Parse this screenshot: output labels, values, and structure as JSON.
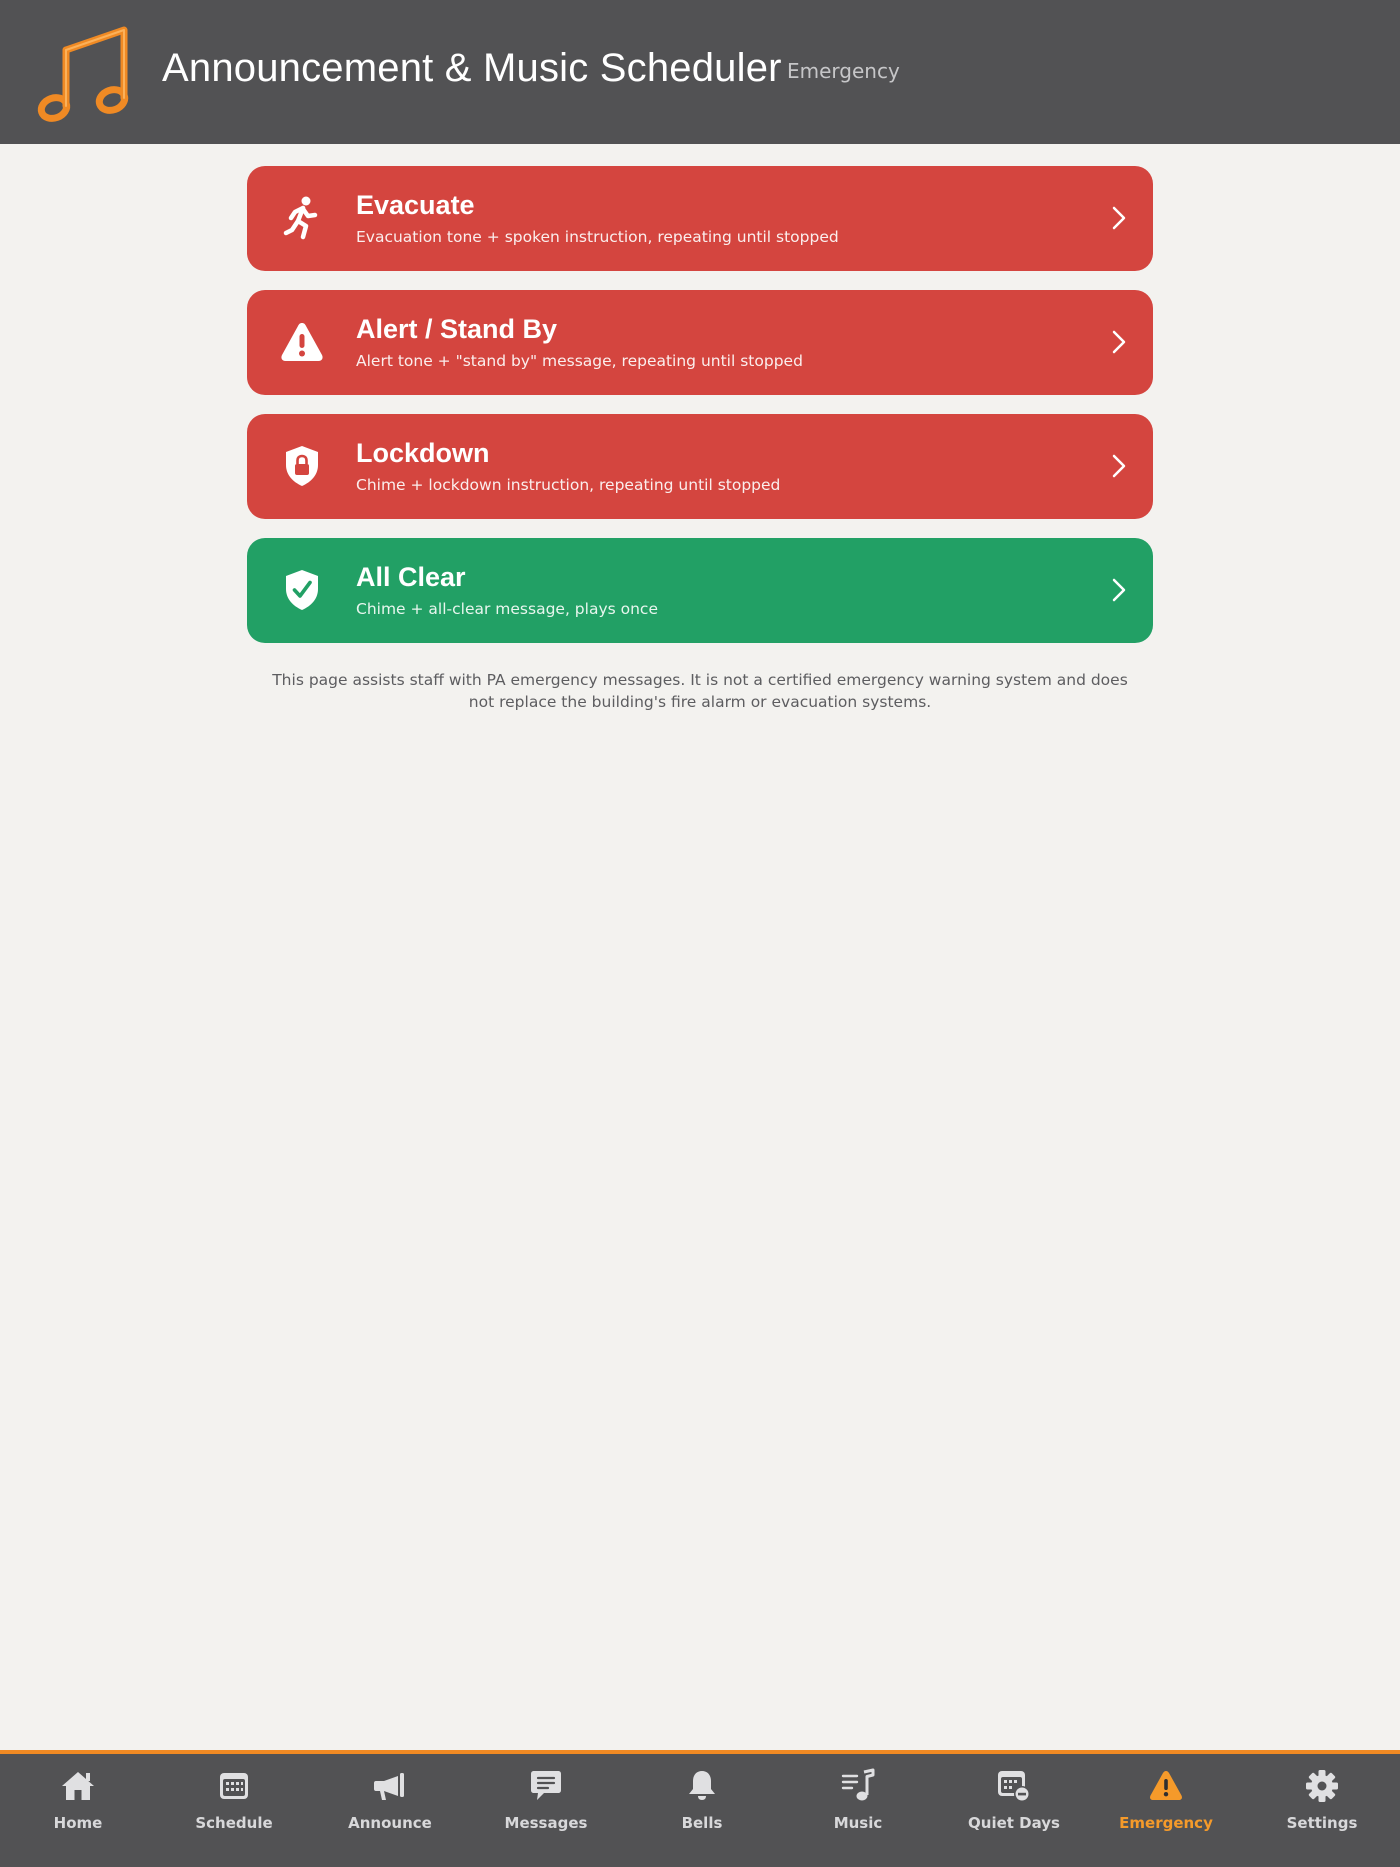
{
  "header": {
    "title": "Announcement & Music Scheduler",
    "page": "Emergency",
    "logo_icon": "music-note-icon",
    "logo_color": "#f08a24"
  },
  "cards": [
    {
      "title": "Evacuate",
      "subtitle": "Evacuation tone + spoken instruction, repeating until stopped",
      "icon": "running-person-icon",
      "color": "#d4453f"
    },
    {
      "title": "Alert / Stand By",
      "subtitle": "Alert tone + \"stand by\" message, repeating until stopped",
      "icon": "warning-triangle-icon",
      "color": "#d4453f"
    },
    {
      "title": "Lockdown",
      "subtitle": "Chime + lockdown instruction, repeating until stopped",
      "icon": "shield-lock-icon",
      "color": "#d4453f"
    },
    {
      "title": "All Clear",
      "subtitle": "Chime + all-clear message, plays once",
      "icon": "shield-check-icon",
      "color": "#22a065"
    }
  ],
  "disclaimer": "This page assists staff with PA emergency messages. It is not a certified emergency warning system and does not replace the building's fire alarm or evacuation systems.",
  "tabs": [
    {
      "label": "Home",
      "icon": "home-icon"
    },
    {
      "label": "Schedule",
      "icon": "calendar-icon"
    },
    {
      "label": "Announce",
      "icon": "megaphone-icon"
    },
    {
      "label": "Messages",
      "icon": "chat-bubble-icon"
    },
    {
      "label": "Bells",
      "icon": "bell-icon"
    },
    {
      "label": "Music",
      "icon": "music-list-icon"
    },
    {
      "label": "Quiet Days",
      "icon": "calendar-minus-icon"
    },
    {
      "label": "Emergency",
      "icon": "warning-triangle-icon",
      "active": true
    },
    {
      "label": "Settings",
      "icon": "gear-icon"
    }
  ],
  "colors": {
    "accent": "#f08a24",
    "header_bg": "#525254",
    "danger": "#d4453f",
    "success": "#22a065",
    "background": "#f3f2ef"
  }
}
